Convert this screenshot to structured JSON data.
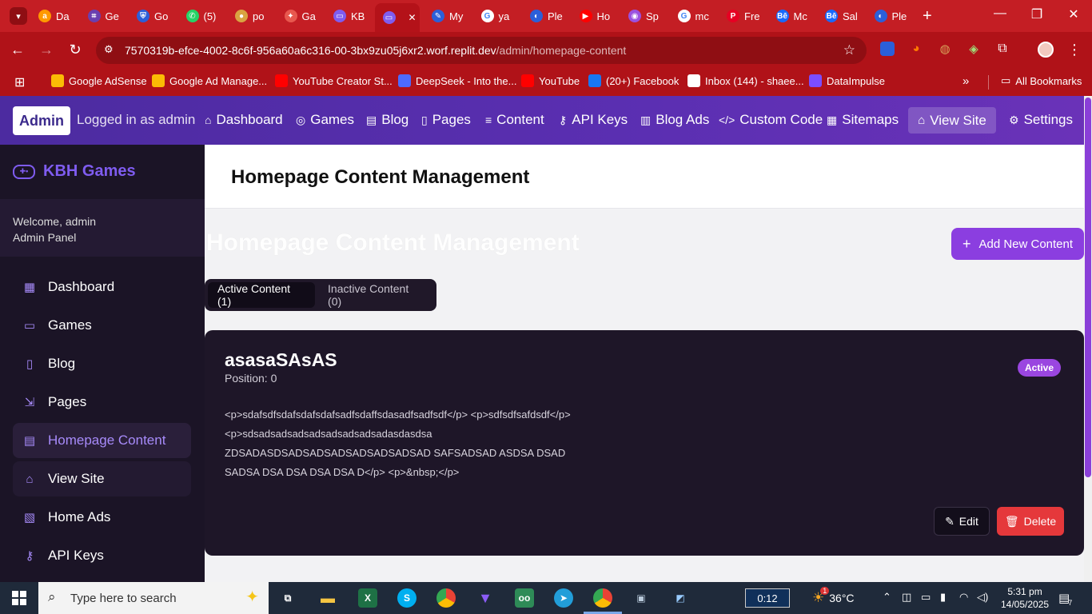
{
  "browser": {
    "tabs": [
      {
        "label": "Da",
        "color": "#ff9900",
        "glyph": "a"
      },
      {
        "label": "Ge",
        "color": "#6a3fb0",
        "glyph": "⌗"
      },
      {
        "label": "Go",
        "color": "#2b5fd9",
        "glyph": "⛨"
      },
      {
        "label": "(5)",
        "color": "#25d366",
        "glyph": "✆"
      },
      {
        "label": "po",
        "color": "#d9a441",
        "glyph": "●"
      },
      {
        "label": "Ga",
        "color": "#e8584e",
        "glyph": "✦"
      },
      {
        "label": "KB",
        "color": "#7f5cf0",
        "glyph": "▭"
      },
      {
        "label": "",
        "color": "#7f5cf0",
        "glyph": "▭"
      },
      {
        "label": "My",
        "color": "#2b5fd9",
        "glyph": "✎"
      },
      {
        "label": "ya",
        "color": "#ffffff",
        "glyph": "G"
      },
      {
        "label": "Ple",
        "color": "#2b5fd9",
        "glyph": "◐"
      },
      {
        "label": "Ho",
        "color": "#ff0000",
        "glyph": "▶"
      },
      {
        "label": "Sp",
        "color": "#9b51e0",
        "glyph": "◉"
      },
      {
        "label": "mc",
        "color": "#ffffff",
        "glyph": "G"
      },
      {
        "label": "Fre",
        "color": "#e60023",
        "glyph": "P"
      },
      {
        "label": "Mc",
        "color": "#1769ff",
        "glyph": "Bē"
      },
      {
        "label": "Sal",
        "color": "#1769ff",
        "glyph": "Bē"
      },
      {
        "label": "Ple",
        "color": "#2b5fd9",
        "glyph": "◐"
      }
    ],
    "active_tab_close": "✕",
    "new_tab": "+",
    "window": {
      "minimize": "—",
      "maximize": "❐",
      "close": "✕"
    },
    "url_host": "7570319b-efce-4002-8c6f-956a60a6c316-00-3bx9zu05j6xr2.worf.replit.dev",
    "url_path": "/admin/homepage-content",
    "bookmarks": [
      {
        "label": "Google AdSense",
        "color": "#fbbc05"
      },
      {
        "label": "Google Ad Manage...",
        "color": "#fbbc05"
      },
      {
        "label": "YouTube Creator St...",
        "color": "#ff0000"
      },
      {
        "label": "DeepSeek - Into the...",
        "color": "#4d6bfe"
      },
      {
        "label": "YouTube",
        "color": "#ff0000"
      },
      {
        "label": "(20+) Facebook",
        "color": "#1877f2"
      },
      {
        "label": "Inbox (144) - shaee...",
        "color": "#ffffff"
      },
      {
        "label": "DataImpulse",
        "color": "#7b4dff"
      }
    ],
    "bookmarks_more": "»",
    "all_bookmarks": "All Bookmarks"
  },
  "admin_nav": {
    "badge": "Admin",
    "logged_in": "Logged in as admin",
    "links": [
      {
        "icon": "⌂",
        "label": "Dashboard"
      },
      {
        "icon": "◎",
        "label": "Games"
      },
      {
        "icon": "▤",
        "label": "Blog"
      },
      {
        "icon": "▯",
        "label": "Pages"
      },
      {
        "icon": "≡",
        "label": "Content"
      },
      {
        "icon": "⚷",
        "label": "API Keys"
      },
      {
        "icon": "▥",
        "label": "Blog Ads"
      },
      {
        "icon": "</>",
        "label": "Custom Code"
      },
      {
        "icon": "▦",
        "label": "Sitemaps"
      }
    ],
    "view_site": "View Site",
    "settings": "Settings"
  },
  "sidebar": {
    "brand": "KBH Games",
    "welcome": "Welcome, admin",
    "panel": "Admin Panel",
    "items": [
      {
        "icon": "▦",
        "label": "Dashboard"
      },
      {
        "icon": "▭",
        "label": "Games"
      },
      {
        "icon": "▯",
        "label": "Blog"
      },
      {
        "icon": "⇲",
        "label": "Pages"
      },
      {
        "icon": "▤",
        "label": "Homepage Content"
      },
      {
        "icon": "⌂",
        "label": "View Site"
      },
      {
        "icon": "▧",
        "label": "Home Ads"
      },
      {
        "icon": "⚷",
        "label": "API Keys"
      }
    ]
  },
  "main": {
    "header_title": "Homepage Content Management",
    "ghost_title": "Homepage Content Management",
    "add_button": "Add New Content",
    "tabs": [
      {
        "label": "Active Content (1)"
      },
      {
        "label": "Inactive Content (0)"
      }
    ],
    "card": {
      "title": "asasaSAsAS",
      "position": "Position: 0",
      "status": "Active",
      "body_lines": [
        "<p>sdafsdfsdafsdafsdafsadfsdaffsdasadfsadfsdf</p> <p>sdfsdfsafdsdf</p>",
        "<p>sdsadsadsadsadsadsadsadsadasdasdsa",
        "ZDSADASDSADSADSADSADSADSADSAD SAFSADSAD ASDSA DSAD",
        "SADSA DSA DSA DSA DSA D</p> <p>&nbsp;</p>"
      ],
      "edit": "Edit",
      "delete": "Delete"
    }
  },
  "taskbar": {
    "search_placeholder": "Type here to search",
    "timer": "0:12",
    "temperature": "36°C",
    "weather_badge": "1",
    "time": "5:31 pm",
    "date": "14/05/2025",
    "notif_count": "7"
  }
}
